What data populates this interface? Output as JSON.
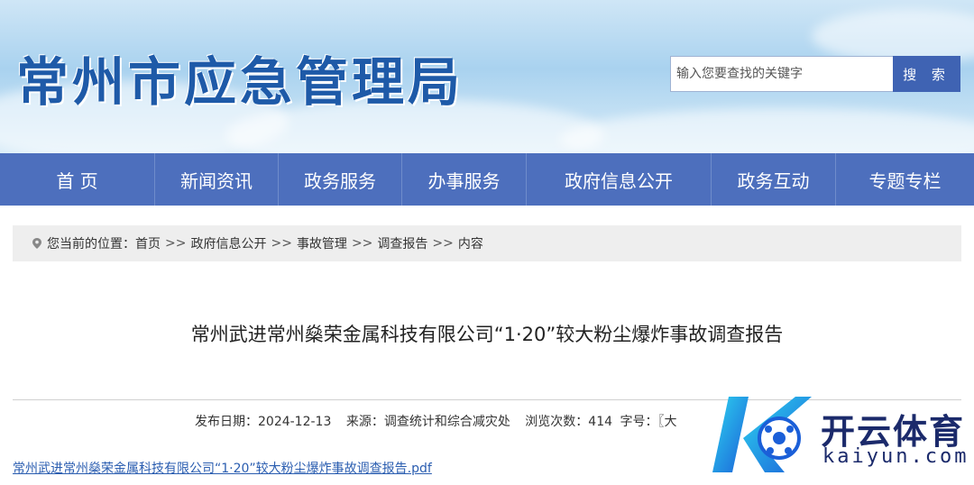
{
  "header": {
    "site_title": "常州市应急管理局",
    "search_placeholder": "输入您要查找的关键字",
    "search_button": "搜 索"
  },
  "nav": {
    "items": [
      "首 页",
      "新闻资讯",
      "政务服务",
      "办事服务",
      "政府信息公开",
      "政务互动",
      "专题专栏"
    ]
  },
  "breadcrumb": {
    "prefix": "您当前的位置：",
    "items": [
      "首页",
      "政府信息公开",
      "事故管理",
      "调查报告",
      "内容"
    ],
    "separator": ">>"
  },
  "article": {
    "title": "常州武进常州燊荣金属科技有限公司“1·20”较大粉尘爆炸事故调查报告",
    "meta": {
      "date_label": "发布日期：",
      "date": "2024-12-13",
      "source_label": "来源：",
      "source": "调查统计和综合减灾处",
      "views_label": "浏览次数：",
      "views": "414",
      "font_label": "字号：",
      "font_value": "〖大"
    },
    "attachment": "常州武进常州燊荣金属科技有限公司“1·20”较大粉尘爆炸事故调查报告.pdf"
  },
  "watermark": {
    "brand": "开云体育",
    "domain": "kaiyun.com"
  },
  "colors": {
    "nav_bg": "#4d6fbd",
    "title_blue": "#1e5aa8",
    "link_blue": "#2a5db0",
    "search_button_bg": "#3f63b3"
  }
}
